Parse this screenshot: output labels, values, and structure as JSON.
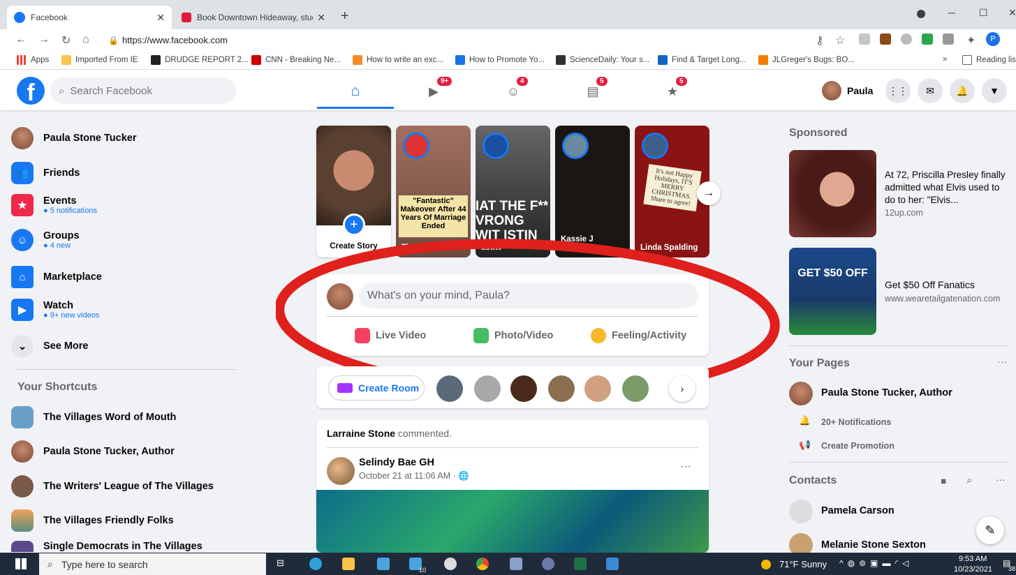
{
  "browser": {
    "tabs": [
      {
        "title": "Facebook",
        "active": true
      },
      {
        "title": "Book Downtown Hideaway, studi",
        "active": false
      }
    ],
    "new_tab": "+",
    "url": "https://www.facebook.com",
    "bookmarks": [
      "Apps",
      "Imported From IE",
      "DRUDGE REPORT 2...",
      "CNN - Breaking Ne...",
      "How to write an exc...",
      "How to Promote Yo...",
      "ScienceDaily: Your s...",
      "Find & Target Long...",
      "JLGreger's Bugs: BO..."
    ],
    "bookmarks_more": "»",
    "reading_list": "Reading lis",
    "profile_letter": "P"
  },
  "header": {
    "search_placeholder": "Search Facebook",
    "badges": {
      "watch": "9+",
      "groups": "4",
      "pages": "5",
      "gaming": "5"
    },
    "user_name": "Paula"
  },
  "left_nav": {
    "profile": "Paula Stone Tucker",
    "items": [
      {
        "label": "Friends",
        "sub": ""
      },
      {
        "label": "Events",
        "sub": "5 notifications"
      },
      {
        "label": "Groups",
        "sub": "4 new"
      },
      {
        "label": "Marketplace",
        "sub": ""
      },
      {
        "label": "Watch",
        "sub": "9+ new videos"
      },
      {
        "label": "See More",
        "sub": ""
      }
    ],
    "shortcuts_title": "Your Shortcuts",
    "shortcuts": [
      "The Villages Word of Mouth",
      "Paula Stone Tucker, Author",
      "The Writers' League of The Villages",
      "The Villages Friendly Folks",
      "Single Democrats in The Villages Social"
    ]
  },
  "stories": [
    {
      "name": "Create Story"
    },
    {
      "name": "Tip Hero",
      "overlay": "\"Fantastic\" Makeover After 44 Years Of Marriage Ended"
    },
    {
      "name": "act.tv",
      "overlay": "IAT THE F** VRONG WIT ISTIN SINEN"
    },
    {
      "name": "Kassie J Runyan -..."
    },
    {
      "name": "Linda Spalding",
      "overlay": "It's not Happy Holidays, IT'S MERRY CHRISTMAS. Share to agree!"
    }
  ],
  "composer": {
    "placeholder": "What's on your mind, Paula?",
    "live_video": "Live Video",
    "photo_video": "Photo/Video",
    "feeling": "Feeling/Activity"
  },
  "rooms": {
    "create_room": "Create Room"
  },
  "post": {
    "commenter": "Larraine Stone",
    "commented": "commented.",
    "author": "Selindy Bae GH",
    "time": "October 21 at 11:06 AM · ",
    "more": "···"
  },
  "sponsored": {
    "title": "Sponsored",
    "ads": [
      {
        "text": "At 72, Priscilla Presley finally admitted what Elvis used to do to her: \"Elvis...",
        "site": "12up.com"
      },
      {
        "text": "Get $50 Off Fanatics",
        "site": "www.wearetailgatenation.com",
        "img_text": "GET $50 OFF"
      }
    ]
  },
  "your_pages": {
    "title": "Your Pages",
    "page": "Paula Stone Tucker, Author",
    "notifications": "20+ Notifications",
    "promotion": "Create Promotion"
  },
  "contacts": {
    "title": "Contacts",
    "list": [
      "Pamela Carson",
      "Melanie Stone Sexton"
    ]
  },
  "taskbar": {
    "search_placeholder": "Type here to search",
    "weather": "71°F  Sunny",
    "time": "9:53 AM",
    "date": "10/23/2021",
    "store_badge": "10",
    "notif_count": "38"
  },
  "colors": {
    "fb_blue": "#1877f2",
    "badge_red": "#e41e3f",
    "bg": "#f0f2f5"
  }
}
